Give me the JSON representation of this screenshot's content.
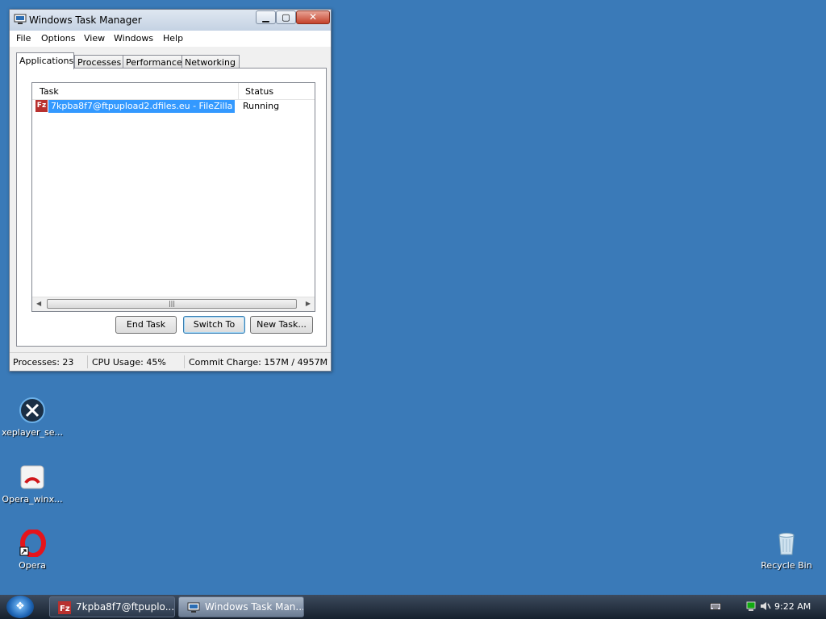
{
  "desktop": {
    "icons": [
      {
        "label": "xeplayer_se..."
      },
      {
        "label": "Opera_winx..."
      },
      {
        "label": "Opera"
      },
      {
        "label": "Recycle Bin"
      }
    ]
  },
  "window": {
    "title": "Windows Task Manager",
    "menu": [
      "File",
      "Options",
      "View",
      "Windows",
      "Help"
    ],
    "tabs": [
      "Applications",
      "Processes",
      "Performance",
      "Networking"
    ],
    "active_tab": "Applications",
    "columns": {
      "task": "Task",
      "status": "Status"
    },
    "rows": [
      {
        "task": "7kpba8f7@ftpupload2.dfiles.eu - FileZilla",
        "status": "Running"
      }
    ],
    "buttons": {
      "end_task": "End Task",
      "switch_to": "Switch To",
      "new_task": "New Task..."
    },
    "statusbar": {
      "processes": "Processes: 23",
      "cpu": "CPU Usage: 45%",
      "commit": "Commit Charge: 157M / 4957M"
    }
  },
  "taskbar": {
    "tasks": [
      {
        "label": "7kpba8f7@ftpuplo...",
        "icon": "filezilla-icon"
      },
      {
        "label": "Windows Task Man...",
        "icon": "task-manager-icon"
      }
    ],
    "clock": "9:22 AM"
  },
  "colors": {
    "desktop": "#3a7ab8",
    "selection": "#3399ff",
    "filezilla": "#b8312f"
  }
}
